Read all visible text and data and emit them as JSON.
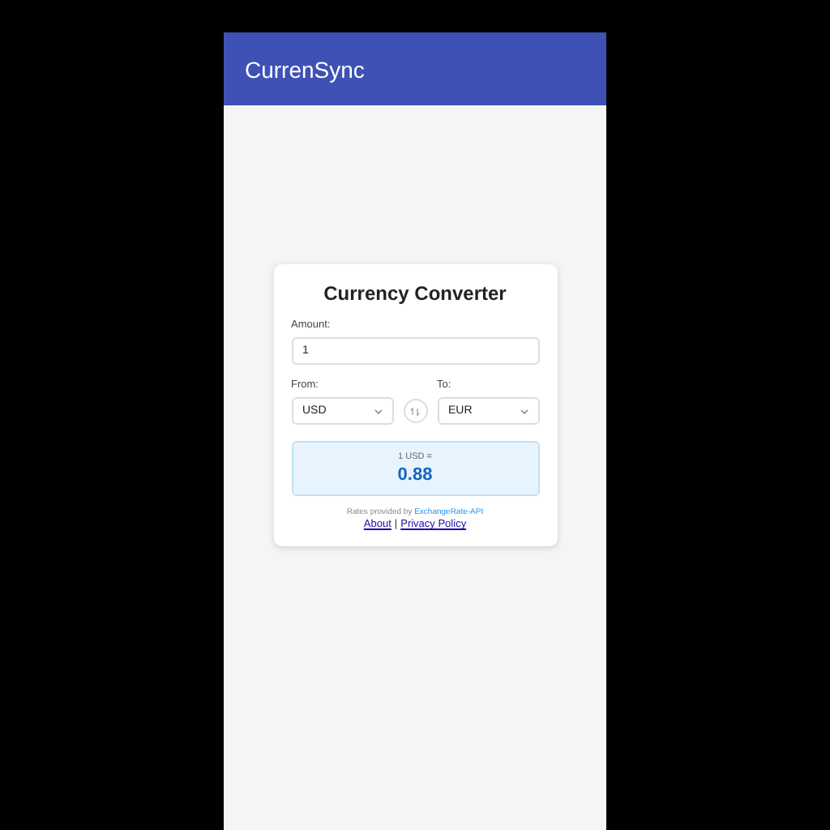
{
  "app_bar": {
    "title": "CurrenSync"
  },
  "converter": {
    "title": "Currency Converter",
    "amount_label": "Amount:",
    "amount_value": "1",
    "from_label": "From:",
    "from_value": "USD",
    "to_label": "To:",
    "to_value": "EUR",
    "result": {
      "caption": "1 USD =",
      "value": "0.88"
    },
    "credit": {
      "text": "Rates provided by",
      "link": "ExchangeRate-API"
    },
    "links": [
      "About",
      "Privacy Policy"
    ],
    "separator": "|"
  }
}
